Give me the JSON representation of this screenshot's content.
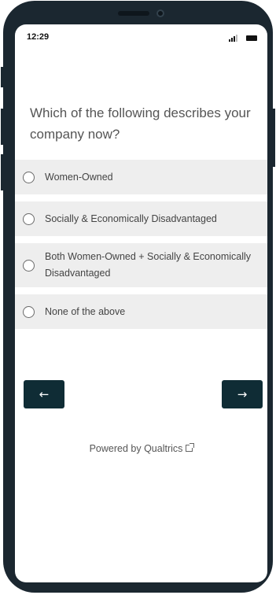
{
  "status_bar": {
    "time": "12:29"
  },
  "survey": {
    "question": "Which of the following describes your company now?",
    "options": [
      {
        "label": "Women-Owned",
        "selected": false
      },
      {
        "label": "Socially & Economically Disadvantaged",
        "selected": false
      },
      {
        "label": "Both Women-Owned + Socially & Economically Disadvantaged",
        "selected": false
      },
      {
        "label": "None of the above",
        "selected": false
      }
    ]
  },
  "navigation": {
    "back_label": "←",
    "next_label": "→"
  },
  "footer": {
    "powered_by": "Powered by Qualtrics"
  },
  "colors": {
    "frame": "#1b2730",
    "option_bg": "#eeeeee",
    "nav_button": "#0f2c35"
  }
}
